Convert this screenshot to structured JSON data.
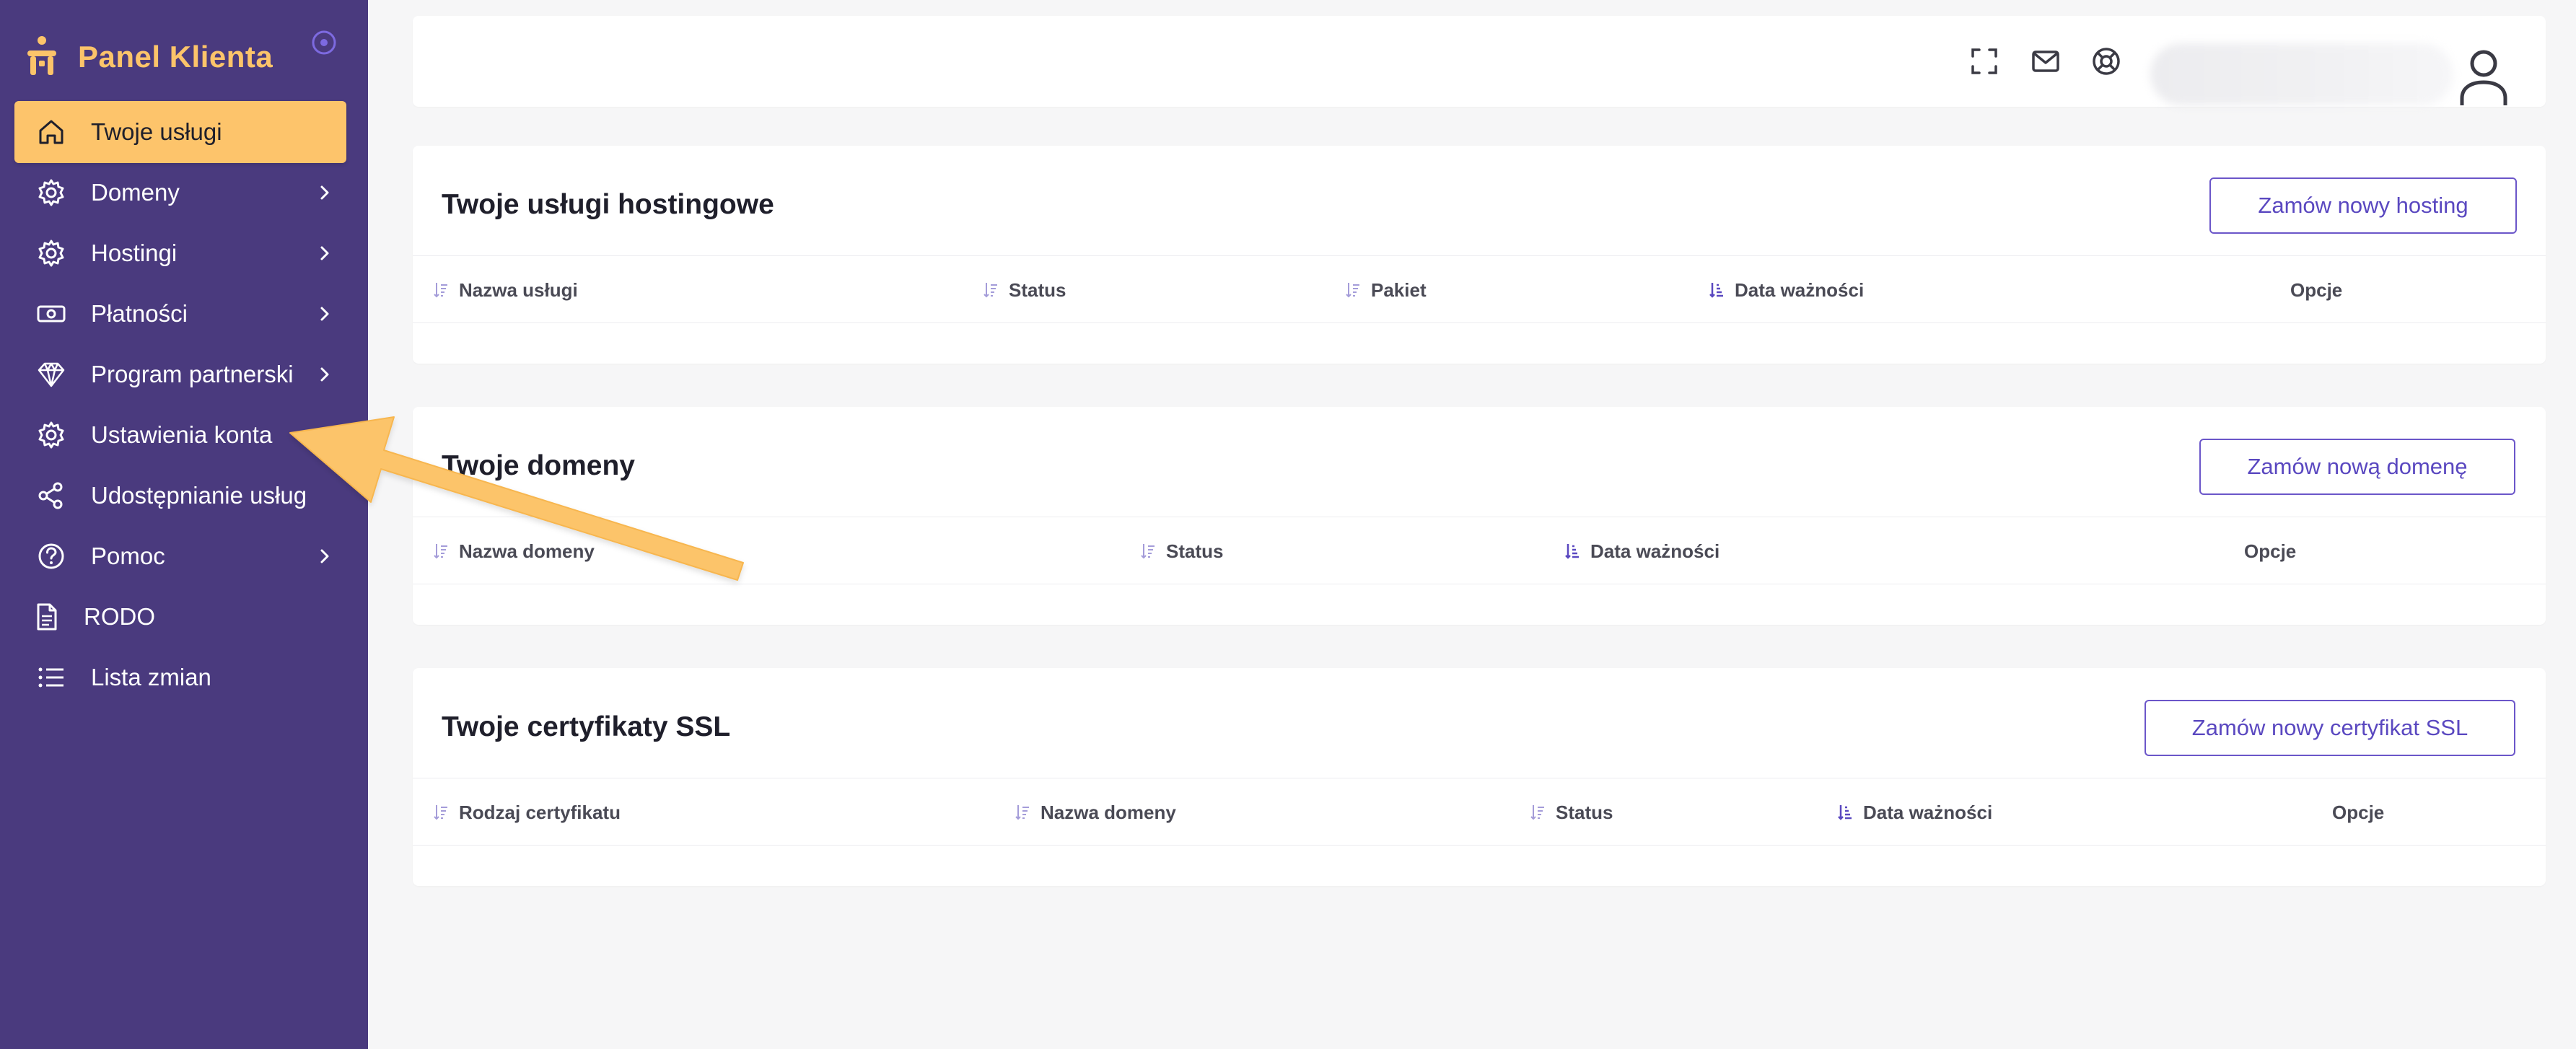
{
  "brand": {
    "title": "Panel Klienta"
  },
  "colors": {
    "sidebar": "#4a3a7e",
    "accent": "#fdc46b",
    "button_border": "#6b56c9",
    "button_text": "#5a48c0"
  },
  "sidebar": {
    "items": [
      {
        "label": "Twoje usługi",
        "icon": "home-icon",
        "active": true,
        "has_submenu": false
      },
      {
        "label": "Domeny",
        "icon": "gear-icon",
        "active": false,
        "has_submenu": true
      },
      {
        "label": "Hostingi",
        "icon": "gear-icon",
        "active": false,
        "has_submenu": true
      },
      {
        "label": "Płatności",
        "icon": "money-icon",
        "active": false,
        "has_submenu": true
      },
      {
        "label": "Program partnerski",
        "icon": "diamond-icon",
        "active": false,
        "has_submenu": true
      },
      {
        "label": "Ustawienia konta",
        "icon": "gear-icon",
        "active": false,
        "has_submenu": false
      },
      {
        "label": "Udostępnianie usług",
        "icon": "share-icon",
        "active": false,
        "has_submenu": false
      },
      {
        "label": "Pomoc",
        "icon": "help-icon",
        "active": false,
        "has_submenu": true
      },
      {
        "label": "RODO",
        "icon": "document-icon",
        "active": false,
        "has_submenu": false
      },
      {
        "label": "Lista zmian",
        "icon": "list-icon",
        "active": false,
        "has_submenu": false
      }
    ]
  },
  "header": {
    "icons": [
      "fullscreen-icon",
      "mail-icon",
      "support-icon",
      "user-icon"
    ]
  },
  "sections": {
    "hosting": {
      "title": "Twoje usługi hostingowe",
      "button": "Zamów nowy hosting",
      "columns": [
        "Nazwa usługi",
        "Status",
        "Pakiet",
        "Data ważności",
        "Opcje"
      ]
    },
    "domains": {
      "title": "Twoje domeny",
      "button": "Zamów nową domenę",
      "columns": [
        "Nazwa domeny",
        "Status",
        "Data ważności",
        "Opcje"
      ]
    },
    "ssl": {
      "title": "Twoje certyfikaty SSL",
      "button": "Zamów nowy certyfikat SSL",
      "columns": [
        "Rodzaj certyfikatu",
        "Nazwa domeny",
        "Status",
        "Data ważności",
        "Opcje"
      ]
    }
  }
}
